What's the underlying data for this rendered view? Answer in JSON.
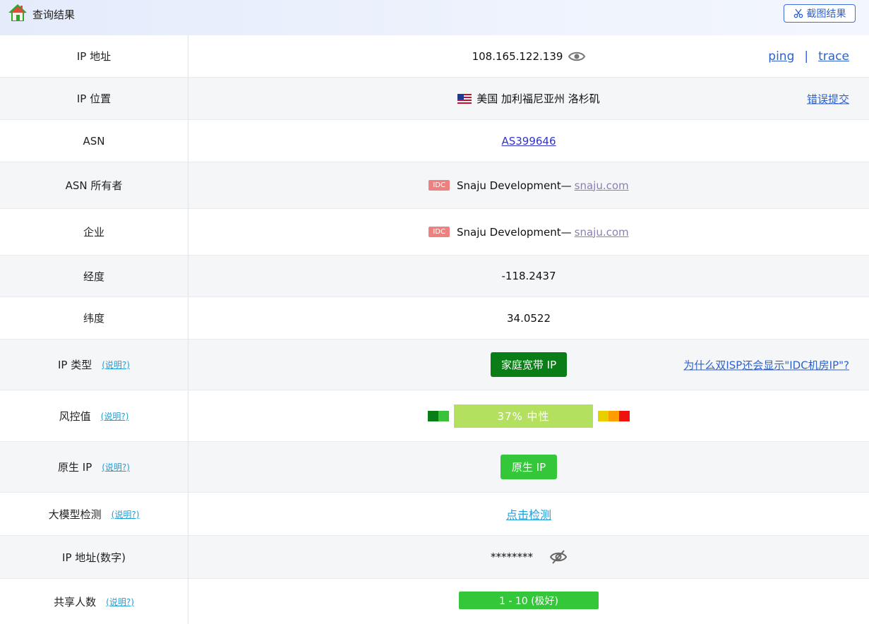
{
  "header": {
    "title": "查询结果",
    "screenshot_button": "截图结果"
  },
  "rows": {
    "ip": {
      "label": "IP 地址",
      "value": "108.165.122.139",
      "ping": "ping",
      "separator": "|",
      "trace": "trace"
    },
    "location": {
      "label": "IP 位置",
      "value": "美国 加利福尼亚州 洛杉矶",
      "error_report": "错误提交"
    },
    "asn": {
      "label": "ASN",
      "value": "AS399646"
    },
    "asn_owner": {
      "label": "ASN 所有者",
      "badge": "IDC",
      "name": "Snaju Development—",
      "domain": "snaju.com"
    },
    "company": {
      "label": "企业",
      "badge": "IDC",
      "name": "Snaju Development—",
      "domain": "snaju.com"
    },
    "longitude": {
      "label": "经度",
      "value": "-118.2437"
    },
    "latitude": {
      "label": "纬度",
      "value": "34.0522"
    },
    "ip_type": {
      "label": "IP 类型",
      "explain": "(说明?)",
      "value": "家庭宽带 IP",
      "why_link": "为什么双ISP还会显示\"IDC机房IP\"?"
    },
    "risk": {
      "label": "风控值",
      "explain": "(说明?)",
      "value": "37%  中性",
      "level_percent": 37
    },
    "native": {
      "label": "原生 IP",
      "explain": "(说明?)",
      "value": "原生 IP"
    },
    "llm": {
      "label": "大模型检测",
      "explain": "(说明?)",
      "value": "点击检测"
    },
    "ip_numeric": {
      "label": "IP 地址(数字)",
      "value": "********"
    },
    "shared": {
      "label": "共享人数",
      "explain": "(说明?)",
      "value": "1 - 10 (极好)"
    }
  },
  "colors": {
    "primary_link": "#2f62c8",
    "explain_link": "#1e9fd6",
    "residential_badge": "#0a7d17",
    "native_badge": "#34c739",
    "risk_bar": "#b3e05f",
    "idc_badge": "#ef8080"
  },
  "icons": {
    "home": "home-icon",
    "scissors": "scissors-icon",
    "eye": "eye-icon",
    "eye_off": "eye-off-icon",
    "flag": "us-flag-icon"
  }
}
